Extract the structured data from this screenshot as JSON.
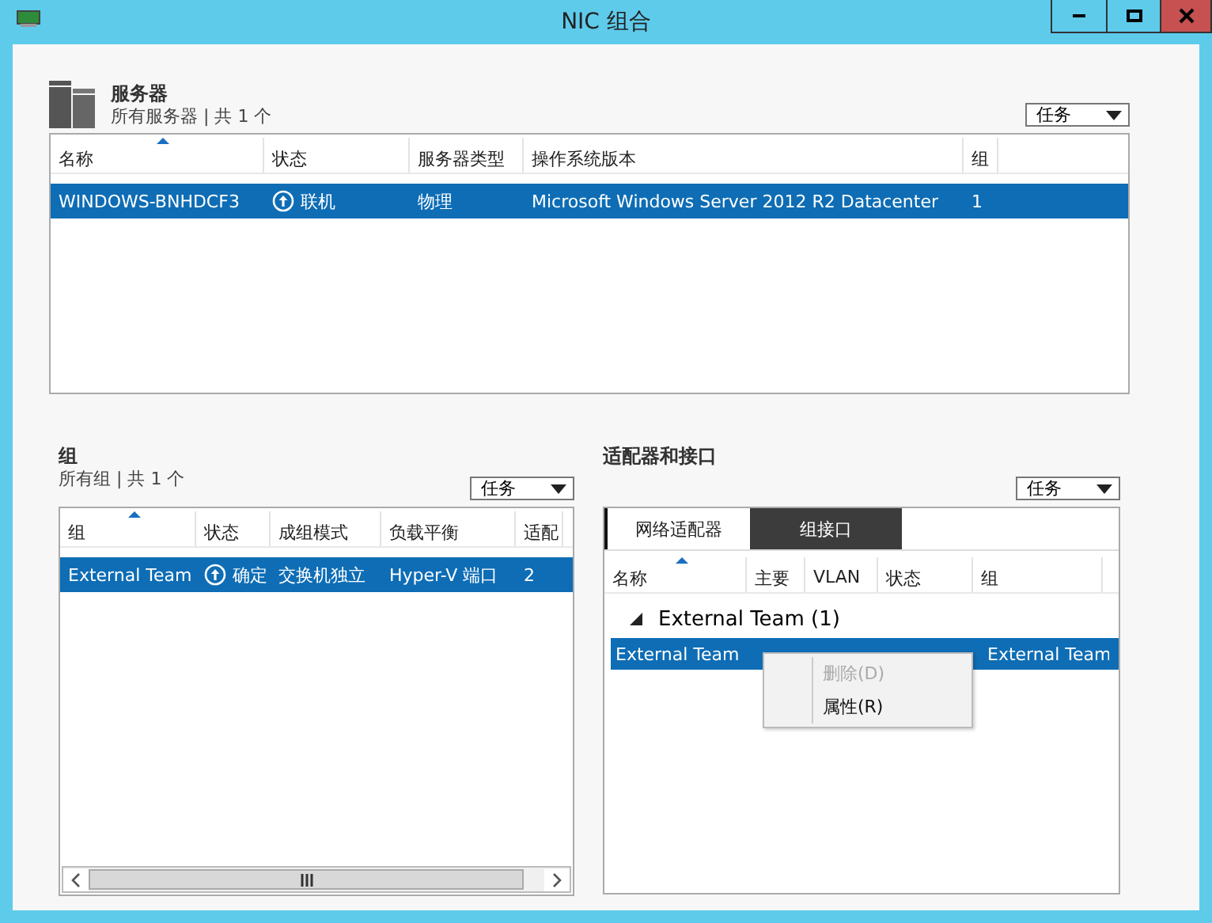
{
  "window": {
    "title": "NIC 组合"
  },
  "servers": {
    "title": "服务器",
    "subtitle": "所有服务器 | 共 1 个",
    "tasks": "任务",
    "columns": [
      {
        "label": "名称",
        "sorted": true
      },
      {
        "label": "状态",
        "sorted": false
      },
      {
        "label": "服务器类型",
        "sorted": false
      },
      {
        "label": "操作系统版本",
        "sorted": false
      },
      {
        "label": "组",
        "sorted": false
      }
    ],
    "rows": [
      {
        "selected": true,
        "cells": [
          "WINDOWS-BNHDCF3",
          "联机",
          "物理",
          "Microsoft Windows Server 2012 R2 Datacenter",
          "1"
        ]
      }
    ]
  },
  "teams": {
    "title": "组",
    "subtitle": "所有组 | 共 1 个",
    "tasks": "任务",
    "columns": [
      {
        "label": "组",
        "sorted": true
      },
      {
        "label": "状态",
        "sorted": false
      },
      {
        "label": "成组模式",
        "sorted": false
      },
      {
        "label": "负载平衡",
        "sorted": false
      },
      {
        "label": "适配",
        "sorted": false
      }
    ],
    "rows": [
      {
        "selected": true,
        "cells": [
          "External Team",
          "确定",
          "交换机独立",
          "Hyper-V 端口",
          "2"
        ]
      }
    ]
  },
  "adapters": {
    "title": "适配器和接口",
    "tasks": "任务",
    "tabs": [
      {
        "label": "网络适配器",
        "selected": false
      },
      {
        "label": "组接口",
        "selected": true
      }
    ],
    "columns": [
      {
        "label": "名称",
        "sorted": true
      },
      {
        "label": "主要",
        "sorted": false
      },
      {
        "label": "VLAN",
        "sorted": false
      },
      {
        "label": "状态",
        "sorted": false
      },
      {
        "label": "组",
        "sorted": false
      }
    ],
    "groups": [
      {
        "label": "External Team (1)",
        "expanded": true,
        "rows": [
          {
            "selected": true,
            "name": "External Team",
            "team": "External Team"
          }
        ]
      }
    ]
  },
  "context_menu": {
    "items": [
      {
        "label": "删除(D)",
        "disabled": true
      },
      {
        "label": "属性(R)",
        "disabled": false
      }
    ]
  }
}
